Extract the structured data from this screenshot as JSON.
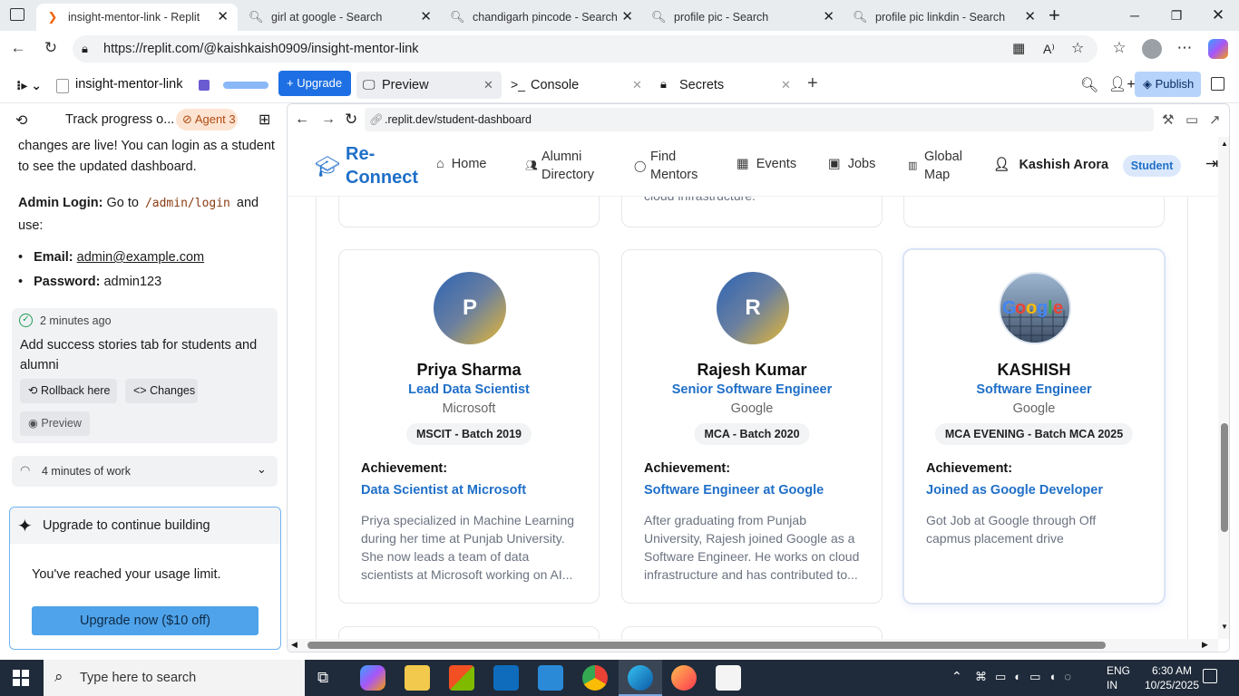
{
  "browser": {
    "tabs": [
      {
        "title": "insight-mentor-link - Replit",
        "active": true
      },
      {
        "title": "girl at google - Search"
      },
      {
        "title": "chandigarh pincode - Search"
      },
      {
        "title": "profile pic - Search"
      },
      {
        "title": "profile pic linkdin - Search"
      }
    ],
    "url": "https://replit.com/@kaishkaish0909/insight-mentor-link"
  },
  "replit": {
    "project_name": "insight-mentor-link",
    "upgrade_label": "Upgrade",
    "tabs": [
      {
        "label": "Preview"
      },
      {
        "label": "Console"
      },
      {
        "label": "Secrets"
      }
    ],
    "publish_label": "Publish"
  },
  "agent": {
    "title": "Track progress o...",
    "agent_badge": "Agent 3",
    "intro": "changes are live! You can login as a student to see the updated dashboard.",
    "admin_bold": "Admin Login:",
    "admin_text": "Go to",
    "admin_code": "/admin/login",
    "admin_and": "and use:",
    "email_label": "Email:",
    "email_value": "admin@example.com",
    "password_label": "Password:",
    "password_value": "admin123",
    "checkpoint_time": "2 minutes ago",
    "checkpoint_text": "Add success stories tab for students and alumni",
    "rollback_label": "Rollback here",
    "changes_label": "Changes",
    "preview_label": "Preview",
    "work_label": "4 minutes of work",
    "upgrade_title": "Upgrade to continue building",
    "limit_text": "You've reached your usage limit.",
    "upgrade_button": "Upgrade now ($10 off)"
  },
  "preview_bar": {
    "url": ".replit.dev/student-dashboard"
  },
  "app": {
    "logo_line1": "Re-",
    "logo_line2": "Connect",
    "nav": [
      {
        "label": "Home"
      },
      {
        "label1": "Alumni",
        "label2": "Directory"
      },
      {
        "label1": "Find",
        "label2": "Mentors"
      },
      {
        "label": "Events"
      },
      {
        "label": "Jobs"
      },
      {
        "label1": "Global",
        "label2": "Map"
      }
    ],
    "user_name": "Kashish Arora",
    "role_badge": "Student",
    "top_card_text": "cloud infrastructure.",
    "achievement_label": "Achievement:",
    "stories": [
      {
        "initial": "P",
        "name": "Priya Sharma",
        "role": "Lead Data Scientist",
        "company": "Microsoft",
        "batch": "MSCIT - Batch 2019",
        "achievement": "Data Scientist at Microsoft",
        "desc1": "Priya specialized in Machine Learning",
        "desc2": "during her time at Punjab University.",
        "desc3": "She now leads a team of data",
        "desc4": "scientists at Microsoft working on AI..."
      },
      {
        "initial": "R",
        "name": "Rajesh Kumar",
        "role": "Senior Software Engineer",
        "company": "Google",
        "batch": "MCA - Batch 2020",
        "achievement": "Software Engineer at Google",
        "desc1": "After graduating from Punjab",
        "desc2": "University, Rajesh joined Google as a",
        "desc3": "Software Engineer. He works on cloud",
        "desc4": "infrastructure and has contributed to..."
      },
      {
        "initial": "",
        "name": "KASHISH",
        "role": "Software Engineer",
        "company": "Google",
        "batch": "MCA EVENING - Batch MCA 2025",
        "achievement": "Joined as Google Developer",
        "desc1": "Got Job at Google through Off",
        "desc2": "capmus placement drive",
        "desc3": "",
        "desc4": ""
      }
    ]
  },
  "taskbar": {
    "search_placeholder": "Type here to search",
    "lang1": "ENG",
    "lang2": "IN",
    "time": "6:30 AM",
    "date": "10/25/2025"
  }
}
